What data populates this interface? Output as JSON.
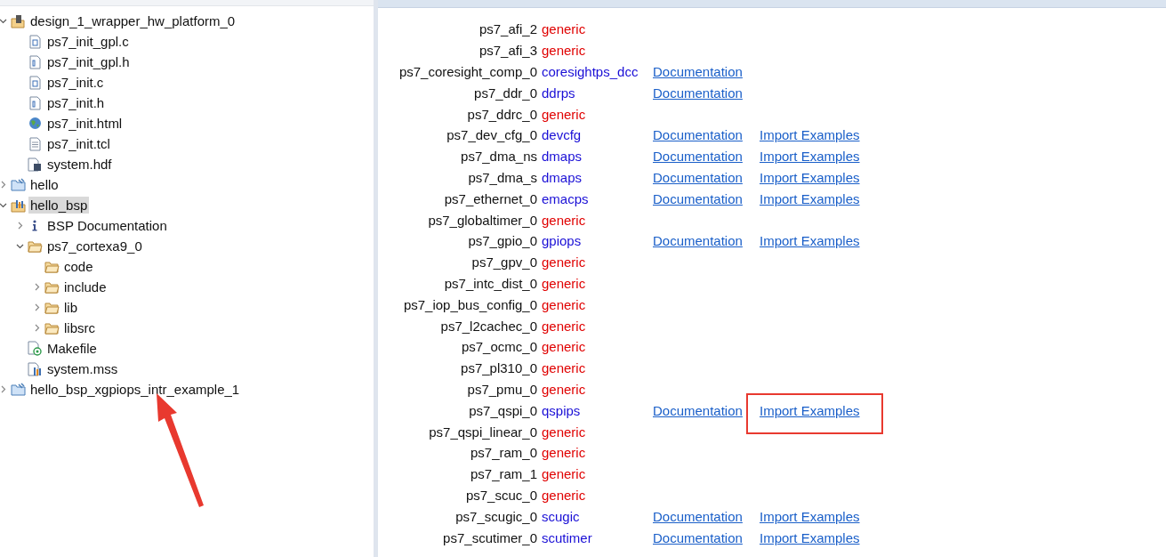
{
  "tree": [
    {
      "label": "design_1_wrapper_hw_platform_0",
      "kind": "hw-project",
      "selected": false,
      "expanded": true,
      "children": [
        {
          "label": "ps7_init_gpl.c",
          "kind": "c-file",
          "selected": false
        },
        {
          "label": "ps7_init_gpl.h",
          "kind": "h-file",
          "selected": false
        },
        {
          "label": "ps7_init.c",
          "kind": "c-file",
          "selected": false
        },
        {
          "label": "ps7_init.h",
          "kind": "h-file",
          "selected": false
        },
        {
          "label": "ps7_init.html",
          "kind": "web-file",
          "selected": false
        },
        {
          "label": "ps7_init.tcl",
          "kind": "text-file",
          "selected": false
        },
        {
          "label": "system.hdf",
          "kind": "hw-file",
          "selected": false
        }
      ]
    },
    {
      "label": "hello",
      "kind": "project",
      "selected": false,
      "expanded": false
    },
    {
      "label": "hello_bsp",
      "kind": "bsp",
      "selected": true,
      "expanded": true,
      "children": [
        {
          "label": "BSP Documentation",
          "kind": "info",
          "selected": false,
          "expanded": false
        },
        {
          "label": "ps7_cortexa9_0",
          "kind": "folder",
          "selected": false,
          "expanded": true,
          "children": [
            {
              "label": "code",
              "kind": "folder",
              "selected": false
            },
            {
              "label": "include",
              "kind": "folder",
              "selected": false,
              "expanded": false
            },
            {
              "label": "lib",
              "kind": "folder",
              "selected": false,
              "expanded": false
            },
            {
              "label": "libsrc",
              "kind": "folder",
              "selected": false,
              "expanded": false
            }
          ]
        },
        {
          "label": "Makefile",
          "kind": "makefile",
          "selected": false
        },
        {
          "label": "system.mss",
          "kind": "mss",
          "selected": false
        }
      ]
    },
    {
      "label": "hello_bsp_xgpiops_intr_example_1",
      "kind": "project",
      "selected": false,
      "expanded": false,
      "arrow": true
    }
  ],
  "peripherals": [
    {
      "name": "ps7_afi_2",
      "driver": "generic",
      "color": "#e00000"
    },
    {
      "name": "ps7_afi_3",
      "driver": "generic",
      "color": "#e00000"
    },
    {
      "name": "ps7_coresight_comp_0",
      "driver": "coresightps_dcc",
      "color": "#1a0fd6",
      "documentation": "Documentation"
    },
    {
      "name": "ps7_ddr_0",
      "driver": "ddrps",
      "color": "#1a0fd6",
      "documentation": "Documentation"
    },
    {
      "name": "ps7_ddrc_0",
      "driver": "generic",
      "color": "#e00000"
    },
    {
      "name": "ps7_dev_cfg_0",
      "driver": "devcfg",
      "color": "#1a0fd6",
      "documentation": "Documentation",
      "import": "Import Examples"
    },
    {
      "name": "ps7_dma_ns",
      "driver": "dmaps",
      "color": "#1a0fd6",
      "documentation": "Documentation",
      "import": "Import Examples"
    },
    {
      "name": "ps7_dma_s",
      "driver": "dmaps",
      "color": "#1a0fd6",
      "documentation": "Documentation",
      "import": "Import Examples"
    },
    {
      "name": "ps7_ethernet_0",
      "driver": "emacps",
      "color": "#1a0fd6",
      "documentation": "Documentation",
      "import": "Import Examples"
    },
    {
      "name": "ps7_globaltimer_0",
      "driver": "generic",
      "color": "#e00000"
    },
    {
      "name": "ps7_gpio_0",
      "driver": "gpiops",
      "color": "#1a0fd6",
      "documentation": "Documentation",
      "import": "Import Examples"
    },
    {
      "name": "ps7_gpv_0",
      "driver": "generic",
      "color": "#e00000"
    },
    {
      "name": "ps7_intc_dist_0",
      "driver": "generic",
      "color": "#e00000"
    },
    {
      "name": "ps7_iop_bus_config_0",
      "driver": "generic",
      "color": "#e00000"
    },
    {
      "name": "ps7_l2cachec_0",
      "driver": "generic",
      "color": "#e00000"
    },
    {
      "name": "ps7_ocmc_0",
      "driver": "generic",
      "color": "#e00000"
    },
    {
      "name": "ps7_pl310_0",
      "driver": "generic",
      "color": "#e00000"
    },
    {
      "name": "ps7_pmu_0",
      "driver": "generic",
      "color": "#e00000"
    },
    {
      "name": "ps7_qspi_0",
      "driver": "qspips",
      "color": "#1a0fd6",
      "documentation": "Documentation",
      "import": "Import Examples",
      "highlighted": true
    },
    {
      "name": "ps7_qspi_linear_0",
      "driver": "generic",
      "color": "#e00000"
    },
    {
      "name": "ps7_ram_0",
      "driver": "generic",
      "color": "#e00000"
    },
    {
      "name": "ps7_ram_1",
      "driver": "generic",
      "color": "#e00000"
    },
    {
      "name": "ps7_scuc_0",
      "driver": "generic",
      "color": "#e00000"
    },
    {
      "name": "ps7_scugic_0",
      "driver": "scugic",
      "color": "#1a0fd6",
      "documentation": "Documentation",
      "import": "Import Examples"
    },
    {
      "name": "ps7_scutimer_0",
      "driver": "scutimer",
      "color": "#1a0fd6",
      "documentation": "Documentation",
      "import": "Import Examples"
    }
  ]
}
